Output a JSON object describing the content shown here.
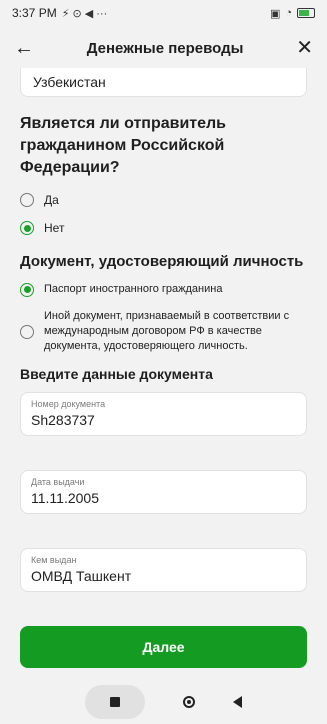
{
  "status_bar": {
    "time": "3:37 PM",
    "extras": "⚡ ⊙ ◀ ···"
  },
  "app_bar": {
    "back_icon": "←",
    "title": "Денежные переводы",
    "close_icon": "✕"
  },
  "country": {
    "value": "Узбекистан"
  },
  "citizenship": {
    "question": "Является ли отправитель гражданином Российской Федерации?",
    "options": [
      {
        "label": "Да",
        "checked": false
      },
      {
        "label": "Нет",
        "checked": true
      }
    ]
  },
  "document": {
    "title": "Документ, удостоверяющий личность",
    "options": [
      {
        "label": "Паспорт иностранного гражданина",
        "checked": true
      },
      {
        "label": "Иной документ, признаваемый в соответствии с международным договором РФ в качестве документа, удостоверяющего личность.",
        "checked": false
      }
    ]
  },
  "doc_data": {
    "title": "Введите данные документа",
    "fields": [
      {
        "label": "Номер документа",
        "value": "Sh283737"
      },
      {
        "label": "Дата выдачи",
        "value": "11.11.2005"
      },
      {
        "label": "Кем выдан",
        "value": "ОМВД Ташкент"
      }
    ]
  },
  "next_button": {
    "label": "Далее"
  },
  "colors": {
    "accent": "#149c22",
    "radio_checked": "#1a9f29"
  }
}
